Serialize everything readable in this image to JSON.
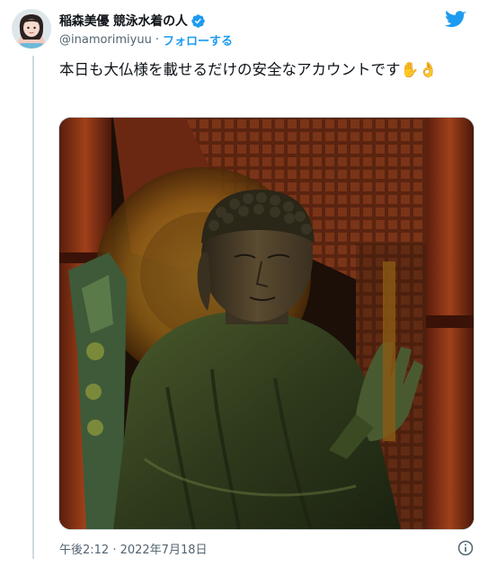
{
  "author": {
    "display_name": "稲森美優 競泳水着の人",
    "handle": "@inamorimiyuu",
    "separator": "·",
    "follow_label": "フォローする"
  },
  "tweet": {
    "text": "本日も大仏様を載せるだけの安全なアカウントです✋👌",
    "timestamp": "午後2:12 · 2022年7月18日"
  },
  "icons": {
    "verified": "verified-badge-icon",
    "brand": "twitter-bird-icon",
    "info": "info-icon"
  },
  "colors": {
    "accent": "#1d9bf0",
    "secondary_text": "#536471",
    "primary_text": "#0f1419"
  }
}
